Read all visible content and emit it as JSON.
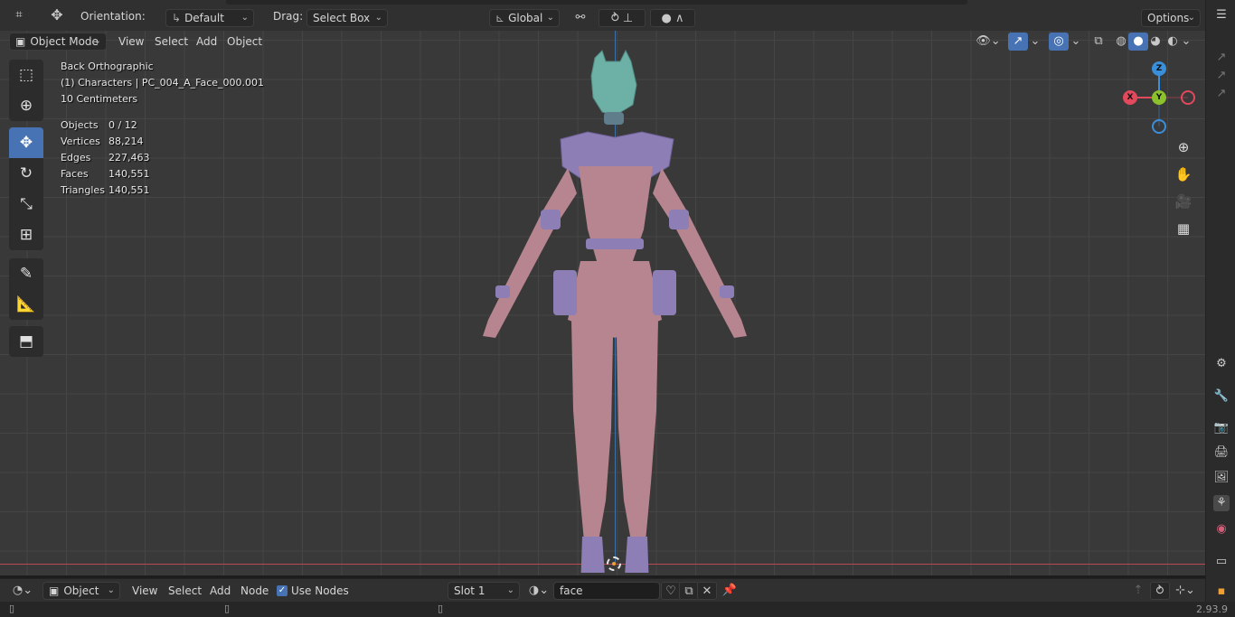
{
  "top_header": {
    "orientation_label": "Orientation:",
    "orientation_value": "Default",
    "drag_label": "Drag:",
    "drag_value": "Select Box",
    "transform_orientation": "Global",
    "options_label": "Options"
  },
  "viewport_header": {
    "mode": "Object Mode",
    "menus": [
      "View",
      "Select",
      "Add",
      "Object"
    ]
  },
  "overlay": {
    "view_name": "Back Orthographic",
    "collection_object": "(1) Characters | PC_004_A_Face_000.001",
    "grid_scale": "10 Centimeters",
    "stats": [
      {
        "label": "Objects",
        "value": "0 / 12"
      },
      {
        "label": "Vertices",
        "value": "88,214"
      },
      {
        "label": "Edges",
        "value": "227,463"
      },
      {
        "label": "Faces",
        "value": "140,551"
      },
      {
        "label": "Triangles",
        "value": "140,551"
      }
    ]
  },
  "gizmo": {
    "z": "Z",
    "y": "Y",
    "x": "X"
  },
  "bottom_header": {
    "editor_mode": "Object",
    "menus": [
      "View",
      "Select",
      "Add",
      "Node"
    ],
    "use_nodes_label": "Use Nodes",
    "slot": "Slot 1",
    "material_name": "face"
  },
  "status": {
    "version": "2.93.9"
  },
  "colors": {
    "accent": "#4772b3",
    "axis_x": "#e2495c",
    "axis_y": "#8bc22c",
    "axis_z": "#3a8fdb",
    "grid": "#393939"
  },
  "icons": [
    "select-box-icon",
    "cursor-icon",
    "move-icon",
    "rotate-icon",
    "scale-icon",
    "transform-icon",
    "annotate-icon",
    "measure-icon",
    "add-cube-icon",
    "zoom-icon",
    "hand-icon",
    "camera-icon",
    "grid-icon"
  ]
}
